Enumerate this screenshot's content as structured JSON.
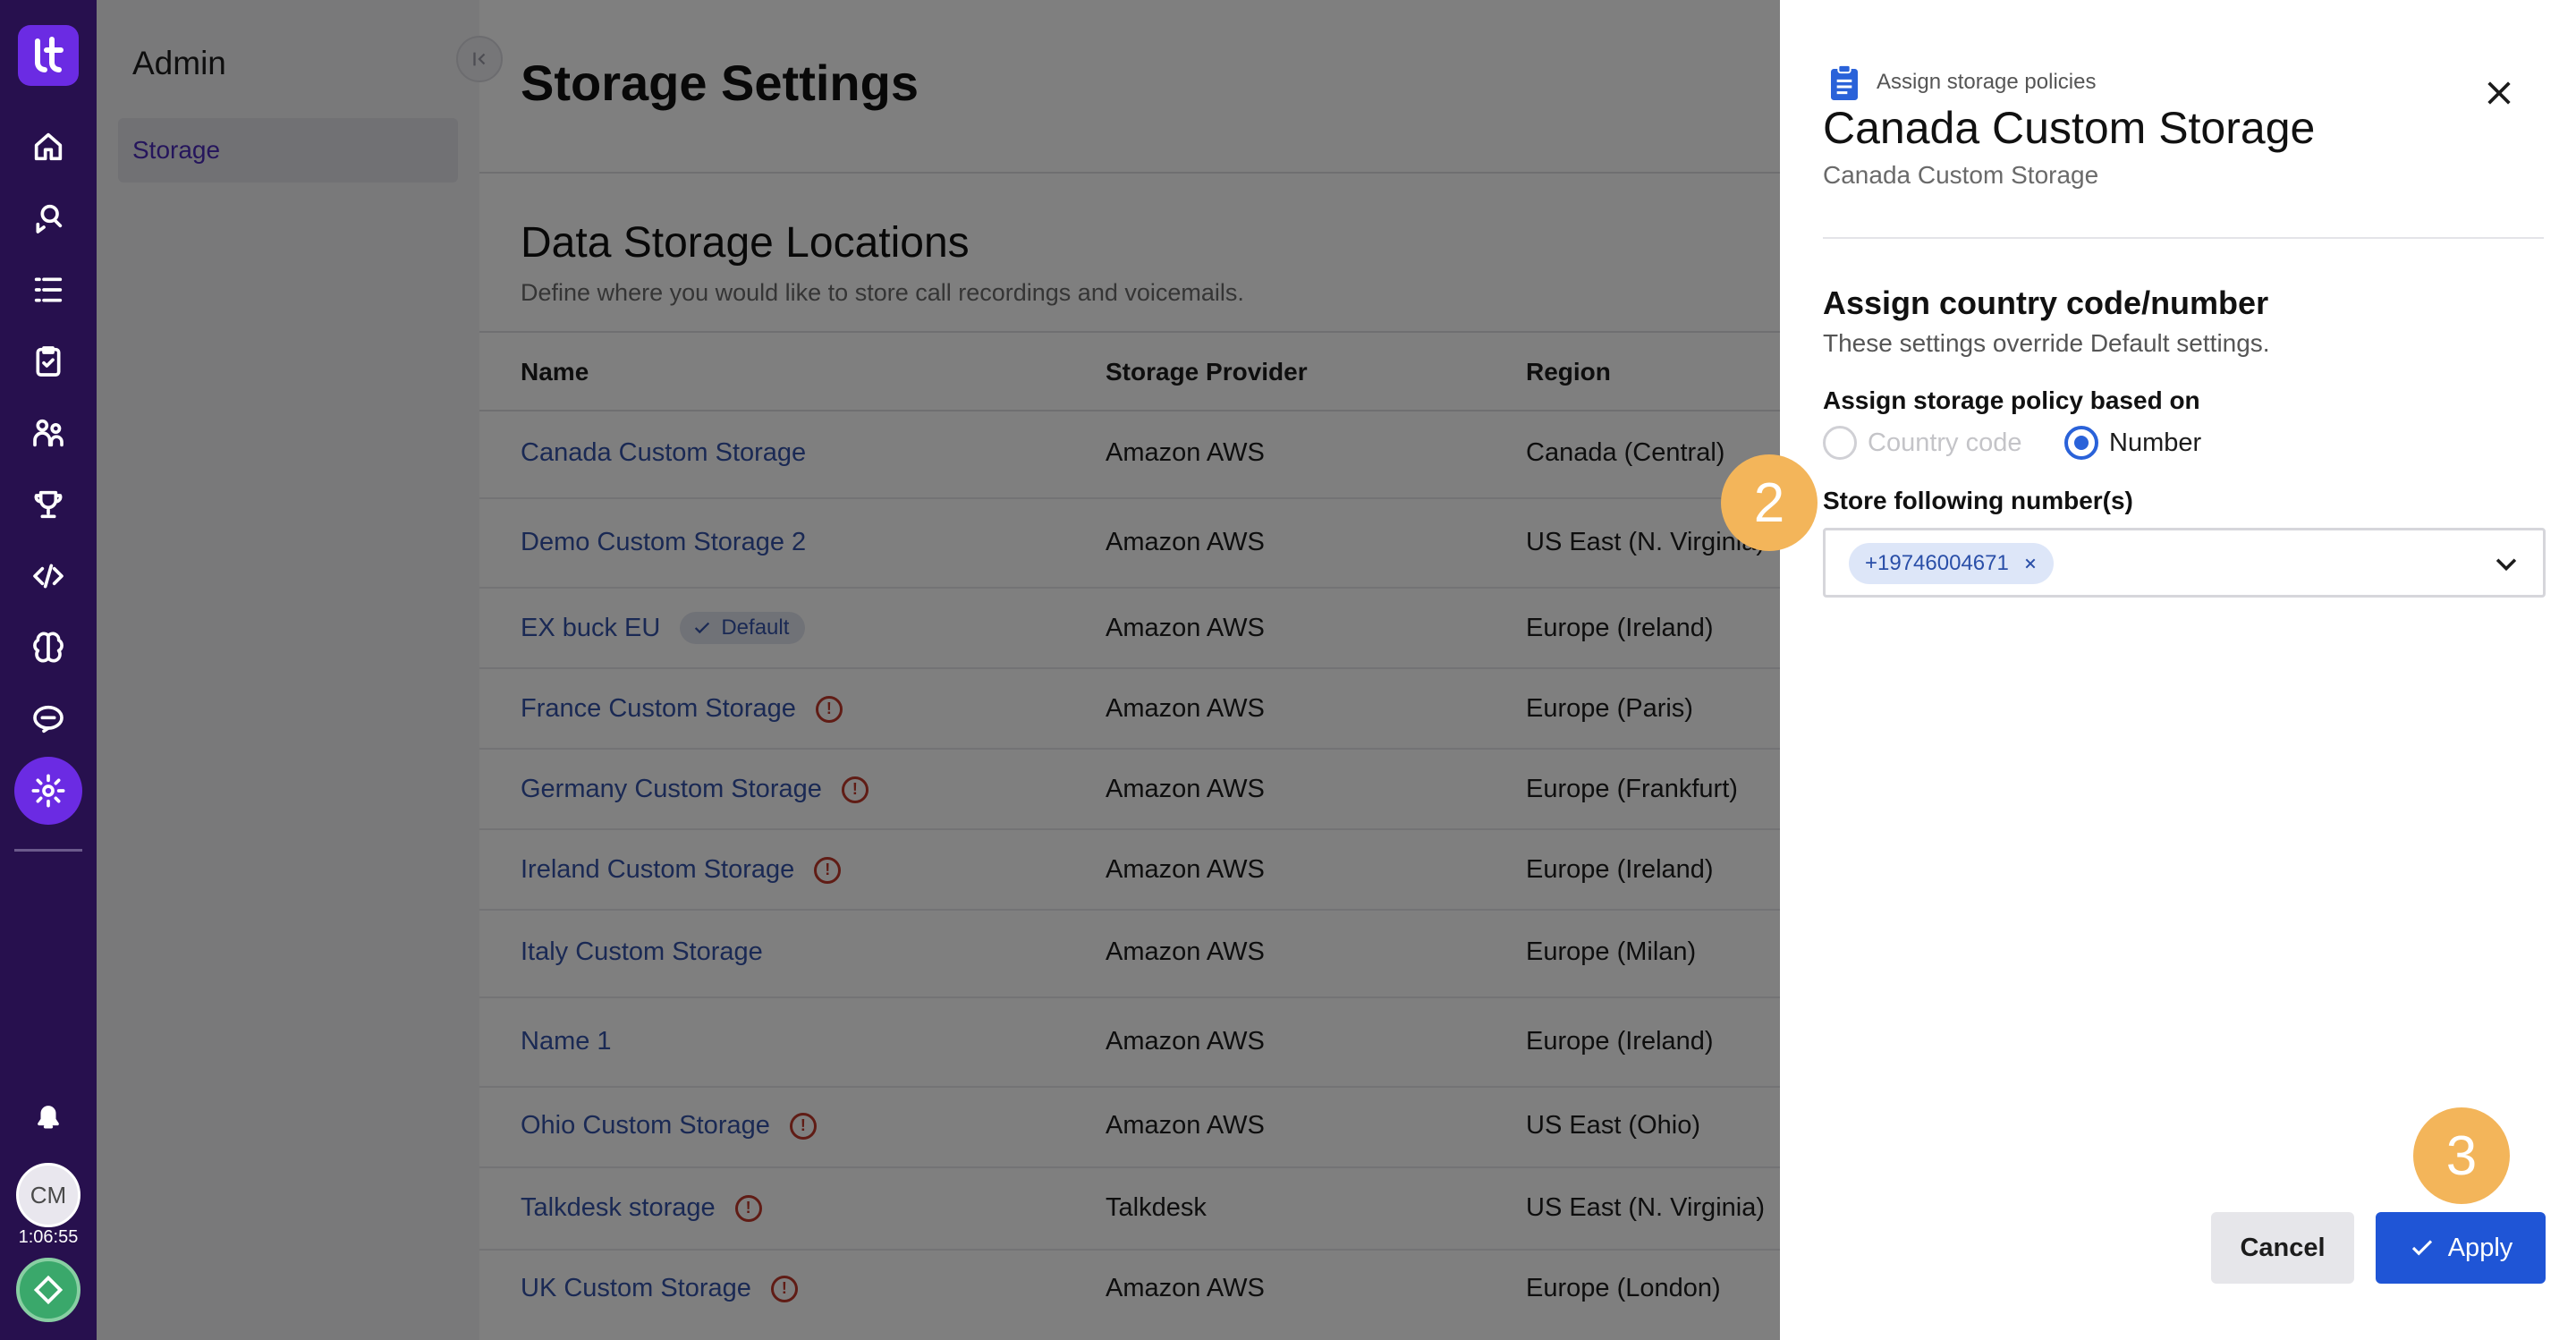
{
  "rail": {
    "avatar_initials": "CM",
    "timer": "1:06:55",
    "icons": [
      "home-icon",
      "agent-icon",
      "list-icon",
      "clipboard-icon",
      "people-icon",
      "trophy-icon",
      "code-icon",
      "brain-icon",
      "chat-icon",
      "settings-icon"
    ],
    "accent": "#6b2be3",
    "background": "#27104e"
  },
  "sidebar": {
    "title": "Admin",
    "items": [
      {
        "label": "Storage",
        "active": true
      }
    ]
  },
  "main": {
    "page_title": "Storage Settings",
    "section_title": "Data Storage Locations",
    "section_subtitle": "Define where you would like to store call recordings and voicemails.",
    "columns": [
      "Name",
      "Storage Provider",
      "Region"
    ],
    "rows": [
      {
        "name": "Canada Custom Storage",
        "provider": "Amazon AWS",
        "region": "Canada (Central)",
        "warning": false,
        "default": false
      },
      {
        "name": "Demo Custom Storage 2",
        "provider": "Amazon AWS",
        "region": "US East (N. Virginia)",
        "warning": false,
        "default": false
      },
      {
        "name": "EX buck EU",
        "provider": "Amazon AWS",
        "region": "Europe (Ireland)",
        "warning": false,
        "default": true,
        "badge": "Default"
      },
      {
        "name": "France Custom Storage",
        "provider": "Amazon AWS",
        "region": "Europe (Paris)",
        "warning": true,
        "default": false
      },
      {
        "name": "Germany Custom Storage",
        "provider": "Amazon AWS",
        "region": "Europe (Frankfurt)",
        "warning": true,
        "default": false
      },
      {
        "name": "Ireland Custom Storage",
        "provider": "Amazon AWS",
        "region": "Europe (Ireland)",
        "warning": true,
        "default": false
      },
      {
        "name": "Italy Custom Storage",
        "provider": "Amazon AWS",
        "region": "Europe (Milan)",
        "warning": false,
        "default": false
      },
      {
        "name": "Name 1",
        "provider": "Amazon AWS",
        "region": "Europe (Ireland)",
        "warning": false,
        "default": false
      },
      {
        "name": "Ohio Custom Storage",
        "provider": "Amazon AWS",
        "region": "US East (Ohio)",
        "warning": true,
        "default": false
      },
      {
        "name": "Talkdesk storage",
        "provider": "Talkdesk",
        "region": "US East (N. Virginia)",
        "warning": true,
        "default": false
      },
      {
        "name": "UK Custom Storage",
        "provider": "Amazon AWS",
        "region": "Europe (London)",
        "warning": true,
        "default": false
      }
    ]
  },
  "drawer": {
    "eyebrow": "Assign storage policies",
    "title": "Canada Custom Storage",
    "subtitle": "Canada Custom Storage",
    "section_title": "Assign country code/number",
    "section_subtitle": "These settings override Default settings.",
    "policy_label": "Assign storage policy based on",
    "options": [
      {
        "label": "Country code",
        "selected": false,
        "disabled": true
      },
      {
        "label": "Number",
        "selected": true,
        "disabled": false
      }
    ],
    "numbers_label": "Store following number(s)",
    "selected_numbers": [
      "+19746004671"
    ],
    "cancel_label": "Cancel",
    "apply_label": "Apply",
    "primary_color": "#1f55d6"
  },
  "steps": [
    "2",
    "3"
  ]
}
